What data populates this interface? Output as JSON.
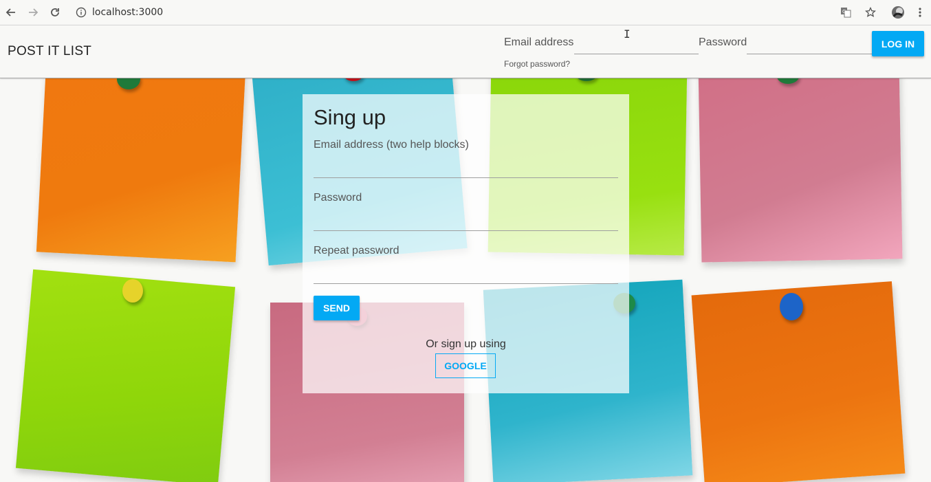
{
  "browser": {
    "url": "localhost:3000",
    "icons": [
      "back-arrow-icon",
      "forward-arrow-icon",
      "reload-icon",
      "info-icon",
      "translate-icon",
      "star-icon",
      "profile-avatar-icon",
      "menu-dots-icon"
    ]
  },
  "header": {
    "brand": "POST IT LIST",
    "email_label": "Email address",
    "password_label": "Password",
    "forgot": "Forgot password?",
    "login_label": "LOG IN"
  },
  "signup": {
    "title": "Sing up",
    "email_label": "Email address (two help blocks)",
    "password_label": "Password",
    "repeat_label": "Repeat password",
    "send_label": "SEND",
    "or_text": "Or sign up using",
    "google_label": "GOOGLE"
  },
  "colors": {
    "accent": "#03a9f4",
    "note_orange": "#f07d10",
    "note_cyan": "#38b8cf",
    "note_green": "#93dd0c",
    "note_pink": "#d57a8e"
  }
}
